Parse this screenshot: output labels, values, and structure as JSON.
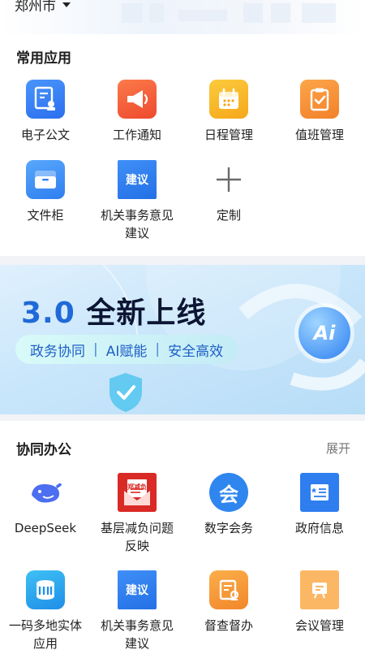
{
  "header": {
    "city": "郑州市"
  },
  "common_apps": {
    "title": "常用应用",
    "items": [
      {
        "label": "电子公文"
      },
      {
        "label": "工作通知"
      },
      {
        "label": "日程管理"
      },
      {
        "label": "值班管理"
      },
      {
        "label": "文件柜"
      },
      {
        "label": "机关事务意见建议",
        "icon_text": "建议"
      },
      {
        "label": "定制"
      }
    ]
  },
  "banner": {
    "version": "3.0",
    "headline": "全新上线",
    "tags": [
      "政务协同",
      "AI赋能",
      "安全高效"
    ],
    "badge": "Ai"
  },
  "collab": {
    "title": "协同办公",
    "expand_label": "展开",
    "items": [
      {
        "label": "DeepSeek"
      },
      {
        "label": "基层减负问题反映",
        "icon_text": "郑减负"
      },
      {
        "label": "数字会务",
        "icon_text": "会"
      },
      {
        "label": "政府信息"
      },
      {
        "label": "一码多地实体应用"
      },
      {
        "label": "机关事务意见建议",
        "icon_text": "建议"
      },
      {
        "label": "督查督办"
      },
      {
        "label": "会议管理"
      }
    ]
  },
  "colors": {
    "blue": "#2f7cf2",
    "orange_red": "#f4613a",
    "yellow": "#f7b727",
    "orange": "#f8952d",
    "red": "#d92a26"
  },
  "icons": {
    "common": [
      "document-seal-icon",
      "megaphone-icon",
      "calendar-icon",
      "clipboard-check-icon",
      "folder-cabinet-icon",
      "suggestion-icon",
      "plus-icon"
    ],
    "collab": [
      "deepseek-whale-icon",
      "feedback-envelope-icon",
      "conference-icon",
      "government-info-icon",
      "multi-site-code-icon",
      "suggestion-icon",
      "supervision-icon",
      "meeting-board-icon"
    ]
  }
}
